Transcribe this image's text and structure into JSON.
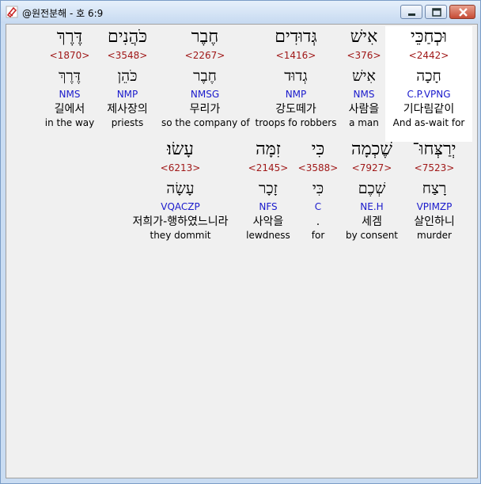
{
  "window": {
    "title": "@원전분해 - 호 6:9",
    "icons": {
      "app": "app-icon",
      "minimize": "minimize-icon",
      "maximize": "maximize-icon",
      "close": "close-icon"
    }
  },
  "rows": [
    {
      "words": [
        {
          "hebrew": "וּכְחַכֵּי",
          "strong": "<2442>",
          "root": "חָכָה",
          "code": "C.P.VPNG",
          "korean": "기다림같이",
          "english": "And as-wait for",
          "selected": true
        },
        {
          "hebrew": "אִישׁ",
          "strong": "<376>",
          "root": "אִישׁ",
          "code": "NMS",
          "korean": "사람을",
          "english": "a man"
        },
        {
          "hebrew": "גְּדוּדִים",
          "strong": "<1416>",
          "root": "גְדוּד",
          "code": "NMP",
          "korean": "강도떼가",
          "english": "troops fo robbers"
        },
        {
          "hebrew": "חֶבֶר",
          "strong": "<2267>",
          "root": "חֶבֶר",
          "code": "NMSG",
          "korean": "무리가",
          "english": "so the company of"
        },
        {
          "hebrew": "כֹּהֲנִים",
          "strong": "<3548>",
          "root": "כֹּהֵן",
          "code": "NMP",
          "korean": "제사장의",
          "english": "priests"
        },
        {
          "hebrew": "דֶּרֶךְ",
          "strong": "<1870>",
          "root": "דֶּרֶךְ",
          "code": "NMS",
          "korean": "길에서",
          "english": "in the way"
        }
      ]
    },
    {
      "words": [
        {
          "hebrew": "יְרַצְּחוּ־",
          "strong": "<7523>",
          "root": "רָצַח",
          "code": "VPIMZP",
          "korean": "살인하니",
          "english": "murder"
        },
        {
          "hebrew": "שֶׁכְמָה",
          "strong": "<7927>",
          "root": "שְׁכֶם",
          "code": "NE.H",
          "korean": "세겜",
          "english": "by consent"
        },
        {
          "hebrew": "כִּי",
          "strong": "<3588>",
          "root": "כִּי",
          "code": "C",
          "korean": ".",
          "english": "for"
        },
        {
          "hebrew": "זִמָּה",
          "strong": "<2145>",
          "root": "זָכָר",
          "code": "NFS",
          "korean": "사악을",
          "english": "lewdness"
        },
        {
          "hebrew": "עָשׂוּ׃",
          "strong": "<6213>",
          "root": "עָשָׂה",
          "code": "VQACZP",
          "korean": "저희가-행하였느니라",
          "english": "they dommit"
        }
      ]
    }
  ]
}
